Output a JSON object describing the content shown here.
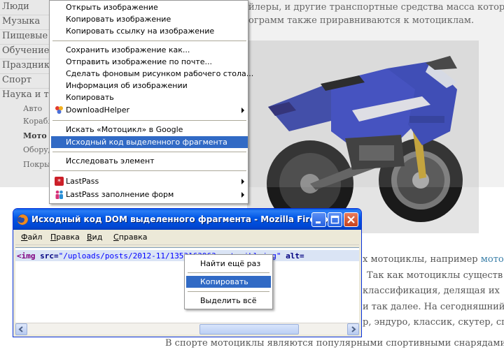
{
  "sidebar": {
    "items": [
      "Люди",
      "Музыка",
      "Пищевые п",
      "Обучение",
      "Праздники",
      "Спорт",
      "Наука и тех"
    ],
    "subitems": [
      "Авто",
      "Корабл",
      "Мото",
      "Оборуд",
      "Покры"
    ]
  },
  "article": {
    "line_top_1": "йлеры, и другие транспортные средства масса которых",
    "line_top_2": "ограмм также приравниваются к мотоциклам.",
    "right_1": "х мотоциклы, например ",
    "right_1_link": "мотоци",
    "right_2": "Так как мотоциклы существ",
    "right_3": "классификация, делящая их",
    "right_4": "и так далее. На сегодняшний д",
    "right_5": "р, эндуро, классик, скутер, спорт",
    "bottom": "В   спорте   мотоциклы   являются   популярными   спортивными   снарядами"
  },
  "context_menu": {
    "items": [
      {
        "label": "Открыть изображение"
      },
      {
        "label": "Копировать изображение"
      },
      {
        "label": "Копировать ссылку на изображение"
      },
      {
        "label": "Сохранить изображение как..."
      },
      {
        "label": "Отправить изображение по почте..."
      },
      {
        "label": "Сделать фоновым рисунком рабочего стола..."
      },
      {
        "label": "Информация об изображении"
      },
      {
        "label": "Копировать"
      },
      {
        "label": "DownloadHelper"
      },
      {
        "label": "Искать «Мотоцикл» в Google"
      },
      {
        "label": "Исходный код выделенного фрагмента"
      },
      {
        "label": "Исследовать элемент"
      },
      {
        "label": "LastPass"
      },
      {
        "label": "LastPass заполнение форм"
      }
    ]
  },
  "window": {
    "title": "Исходный код DOM выделенного фрагмента - Mozilla Firefox",
    "menu": {
      "file": "Файл",
      "file_u": "Ф",
      "file_rest": "айл",
      "edit_u": "П",
      "edit_rest": "равка",
      "view_u": "В",
      "view_rest": "ид",
      "help_u": "С",
      "help_rest": "правка"
    },
    "source": {
      "tag_open": "<img",
      "attr_src": " src=",
      "src_value": "\"/uploads/posts/2012-11/1353163963_motocikl.jpg\"",
      "attr_alt": " alt="
    }
  },
  "small_menu": {
    "items": [
      {
        "label": "Найти ещё раз"
      },
      {
        "label": "Копировать"
      },
      {
        "label": "Выделить всё"
      }
    ]
  },
  "colors": {
    "highlight": "#316ac5",
    "titlebar": "#0055e5",
    "window_bg": "#ece9d8",
    "link": "#3a7fa8"
  }
}
